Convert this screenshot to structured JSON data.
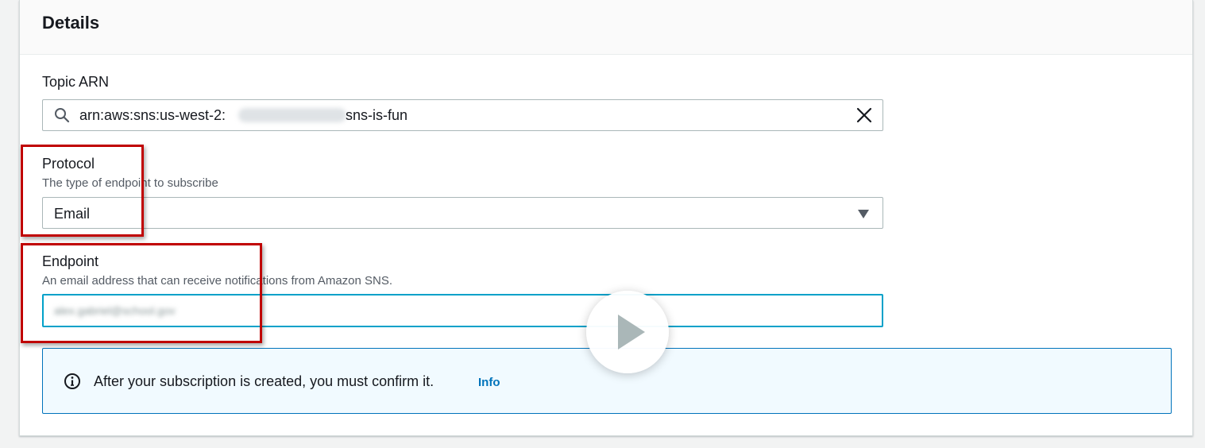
{
  "panel": {
    "title": "Details"
  },
  "topic_arn": {
    "label": "Topic ARN",
    "value_prefix": "arn:aws:sns:us-west-2:",
    "value_suffix": "sns-is-fun"
  },
  "protocol": {
    "label": "Protocol",
    "description": "The type of endpoint to subscribe",
    "selected": "Email"
  },
  "endpoint": {
    "label": "Endpoint",
    "description": "An email address that can receive notifications from Amazon SNS.",
    "value": "alex.gabriel@school.gov"
  },
  "alert": {
    "message": "After your subscription is created, you must confirm it.",
    "link": "Info"
  },
  "icons": {
    "search": "search-icon",
    "clear": "close-icon",
    "dropdown": "caret-down-icon",
    "info": "info-icon",
    "play": "play-icon"
  },
  "colors": {
    "accent": "#0073bb",
    "focus": "#00a1c9",
    "highlight": "#c00000",
    "alert_bg": "#f1faff"
  }
}
